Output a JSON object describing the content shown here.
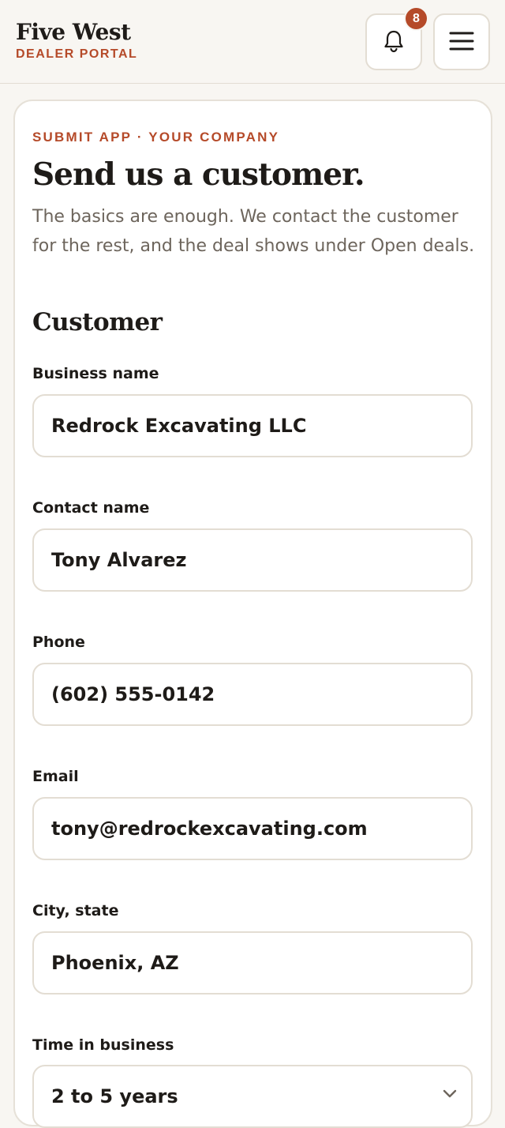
{
  "header": {
    "brand_name": "Five West",
    "brand_sub": "DEALER PORTAL",
    "notification_count": "8",
    "bell_icon": "bell-icon",
    "menu_icon": "hamburger-menu-icon"
  },
  "form": {
    "eyebrow": "SUBMIT APP · YOUR COMPANY",
    "title": "Send us a customer.",
    "intro": "The basics are enough. We contact the customer for the rest, and the deal shows under Open deals.",
    "section_title": "Customer",
    "fields": [
      {
        "label": "Business name",
        "value": "Redrock Excavating LLC"
      },
      {
        "label": "Contact name",
        "value": "Tony Alvarez"
      },
      {
        "label": "Phone",
        "value": "(602) 555-0142"
      },
      {
        "label": "Email",
        "value": "tony@redrockexcavating.com"
      },
      {
        "label": "City, state",
        "value": "Phoenix, AZ"
      }
    ],
    "time_in_business": {
      "label": "Time in business",
      "selected": "2 to 5 years"
    }
  },
  "colors": {
    "accent": "#b54a29",
    "text": "#1e1b18",
    "muted": "#6d655c",
    "border": "#e3ddd3",
    "background": "#f8f6f2"
  }
}
